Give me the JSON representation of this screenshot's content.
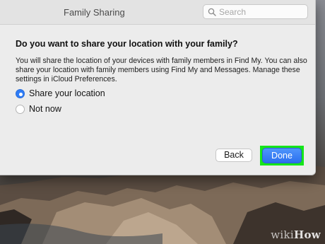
{
  "window": {
    "title": "Family Sharing",
    "search_placeholder": "Search"
  },
  "dialog": {
    "heading": "Do you want to share your location with your family?",
    "description": "You will share the location of your devices with family members in Find My. You can also share your location with family members using Find My and Messages. Manage these settings in iCloud Preferences.",
    "options": [
      {
        "label": "Share your location",
        "selected": true
      },
      {
        "label": "Not now",
        "selected": false
      }
    ],
    "back_label": "Back",
    "done_label": "Done"
  },
  "colors": {
    "accent_blue": "#2f7cf6",
    "highlight_green": "#15e61a"
  },
  "watermark": {
    "part1": "wiki",
    "part2": "How"
  }
}
